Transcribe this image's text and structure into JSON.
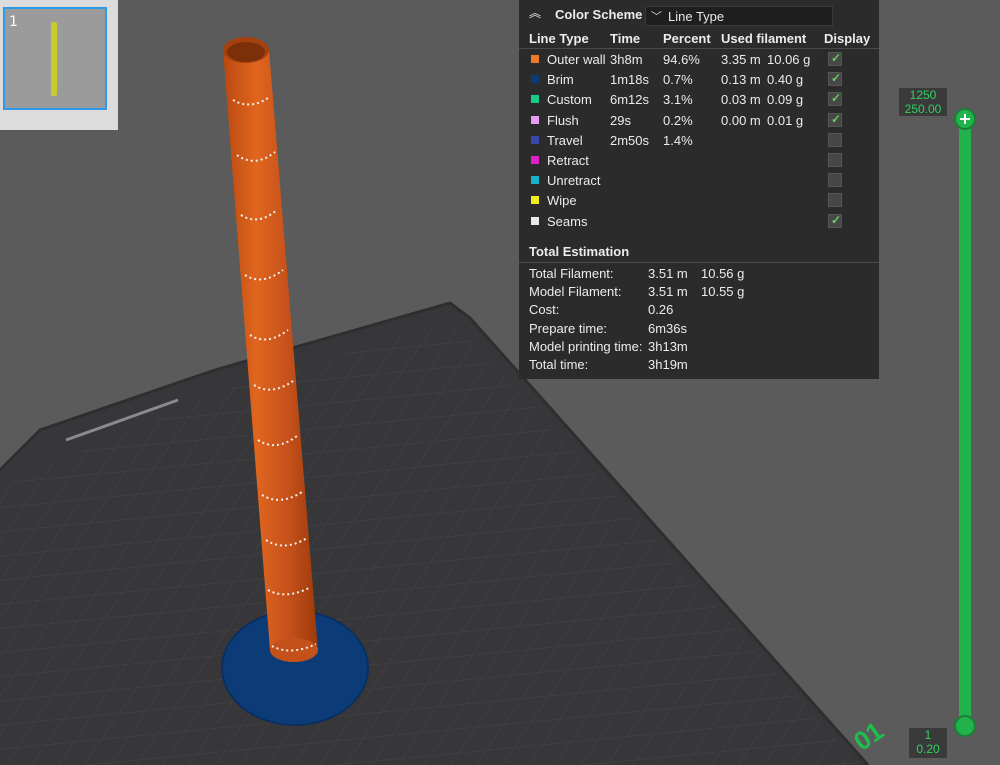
{
  "plate_thumbnail": {
    "number": "1"
  },
  "legend": {
    "title": "Color Scheme",
    "scheme_value": "Line Type",
    "columns": [
      "Line Type",
      "Time",
      "Percent",
      "Used filament",
      "Display"
    ],
    "rows": [
      {
        "name": "Outer wall",
        "time": "3h8m",
        "percent": "94.6%",
        "length": "3.35 m",
        "weight": "10.06 g",
        "color": "#f07a2a",
        "display": true
      },
      {
        "name": "Brim",
        "time": "1m18s",
        "percent": "0.7%",
        "length": "0.13 m",
        "weight": "0.40 g",
        "color": "#0c3c78",
        "display": true
      },
      {
        "name": "Custom",
        "time": "6m12s",
        "percent": "3.1%",
        "length": "0.03 m",
        "weight": "0.09 g",
        "color": "#18cc88",
        "display": true
      },
      {
        "name": "Flush",
        "time": "29s",
        "percent": "0.2%",
        "length": "0.00 m",
        "weight": "0.01 g",
        "color": "#e49cf0",
        "display": true
      },
      {
        "name": "Travel",
        "time": "2m50s",
        "percent": "1.4%",
        "length": "",
        "weight": "",
        "color": "#3848a8",
        "display": false
      },
      {
        "name": "Retract",
        "time": "",
        "percent": "",
        "length": "",
        "weight": "",
        "color": "#e020c8",
        "display": false
      },
      {
        "name": "Unretract",
        "time": "",
        "percent": "",
        "length": "",
        "weight": "",
        "color": "#18b0c8",
        "display": false
      },
      {
        "name": "Wipe",
        "time": "",
        "percent": "",
        "length": "",
        "weight": "",
        "color": "#f0ec18",
        "display": false
      },
      {
        "name": "Seams",
        "time": "",
        "percent": "",
        "length": "",
        "weight": "",
        "color": "#e8e8e8",
        "display": true
      }
    ],
    "total_title": "Total Estimation",
    "totals": [
      {
        "label": "Total Filament:",
        "v1": "3.51 m",
        "v2": "10.56 g"
      },
      {
        "label": "Model Filament:",
        "v1": "3.51 m",
        "v2": "10.55 g"
      },
      {
        "label": "Cost:",
        "v1": "0.26",
        "v2": ""
      },
      {
        "label": "Prepare time:",
        "v1": "6m36s",
        "v2": ""
      },
      {
        "label": "Model printing time:",
        "v1": "3h13m",
        "v2": ""
      },
      {
        "label": "Total time:",
        "v1": "3h19m",
        "v2": ""
      }
    ]
  },
  "layer_slider": {
    "top_layer": "1250",
    "top_height": "250.00",
    "bottom_layer": "1",
    "bottom_height": "0.20"
  },
  "plate_label": "01",
  "colors": {
    "accent": "#22b24c",
    "model": "#d0561a",
    "brim": "#0c3c78",
    "background": "#5b5b5c",
    "plate": "#3a3a3c"
  }
}
